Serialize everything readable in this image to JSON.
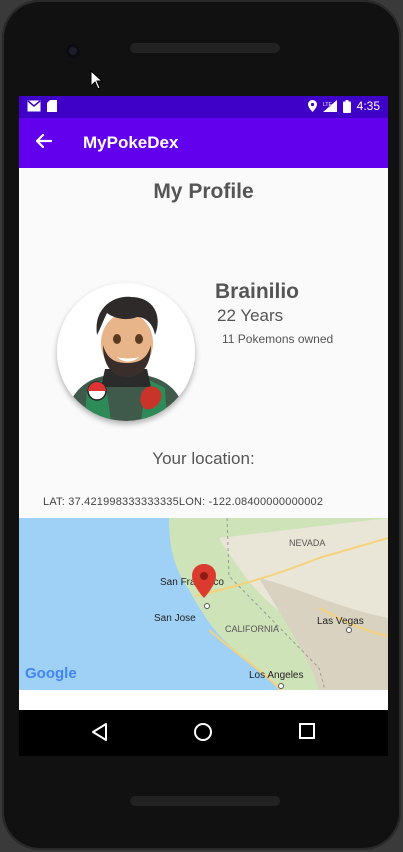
{
  "status_bar": {
    "time": "4:35",
    "left_icons": [
      "gmail-icon",
      "sd-card-icon"
    ],
    "right_icons": [
      "location-icon",
      "signal-icon",
      "battery-icon"
    ]
  },
  "app_bar": {
    "title": "MyPokeDex",
    "back_icon": "arrow-back-icon"
  },
  "profile": {
    "heading": "My Profile",
    "name": "Brainilio",
    "age": "22 Years",
    "pokemons_owned": "11 Pokemons owned"
  },
  "location": {
    "heading": "Your location:",
    "coords_text": "LAT:  37.421998333333335LON:   -122.08400000000002"
  },
  "map": {
    "labels": {
      "nevada": "NEVADA",
      "san_francisco": "San Francisco",
      "san_jose": "San Jose",
      "california": "CALIFORNIA",
      "las_vegas": "Las Vegas",
      "los_angeles": "Los Angeles"
    },
    "logo": "Google",
    "pin_color": "#db3b2f"
  },
  "colors": {
    "primary": "#6200ee",
    "primary_dark": "#3f00c8"
  },
  "nav": {
    "back_icon": "nav-back-icon",
    "home_icon": "nav-home-icon",
    "recents_icon": "nav-recents-icon"
  }
}
